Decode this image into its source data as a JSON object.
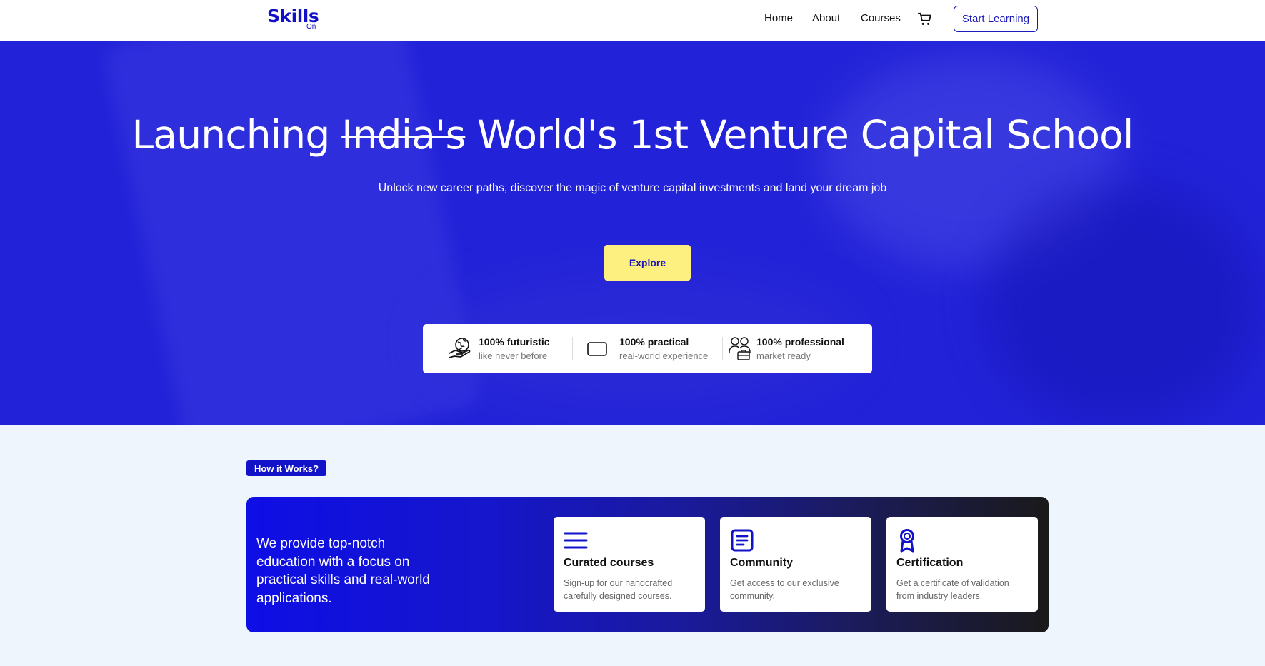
{
  "nav": {
    "logo_main": "Skills",
    "logo_sub": "On",
    "links": [
      "Home",
      "About",
      "Courses"
    ],
    "cart_icon": "cart-icon",
    "cta": "Start Learning"
  },
  "hero": {
    "title_pre": "Launching",
    "title_strike": "India's",
    "title_post": "World's 1st Venture Capital School",
    "subtitle": "Unlock new career paths, discover the magic of venture capital investments and land your dream job",
    "explore": "Explore",
    "features": [
      {
        "title": "100% futuristic",
        "subtitle": "like never before",
        "icon": "globe-hand-icon"
      },
      {
        "title": "100% practical",
        "subtitle": "real-world experience",
        "icon": "card-icon"
      },
      {
        "title": "100% professional",
        "subtitle": "market ready",
        "icon": "team-icon"
      }
    ]
  },
  "how": {
    "badge": "How it Works?",
    "text": "We provide top-notch education with a focus on practical skills and real-world applications.",
    "cards": [
      {
        "title": "Curated courses",
        "desc": "Sign-up for our handcrafted carefully designed courses.",
        "icon": "menu-lines-icon"
      },
      {
        "title": "Community",
        "desc": "Get access to our exclusive community.",
        "icon": "document-icon"
      },
      {
        "title": "Certification",
        "desc": "Get a certificate of validation from industry leaders.",
        "icon": "award-icon"
      }
    ]
  },
  "colors": {
    "brand": "#1010c8",
    "hero_bg": "#2222d8",
    "explore_bg": "#fdf081",
    "page_bg": "#eef5fd"
  }
}
